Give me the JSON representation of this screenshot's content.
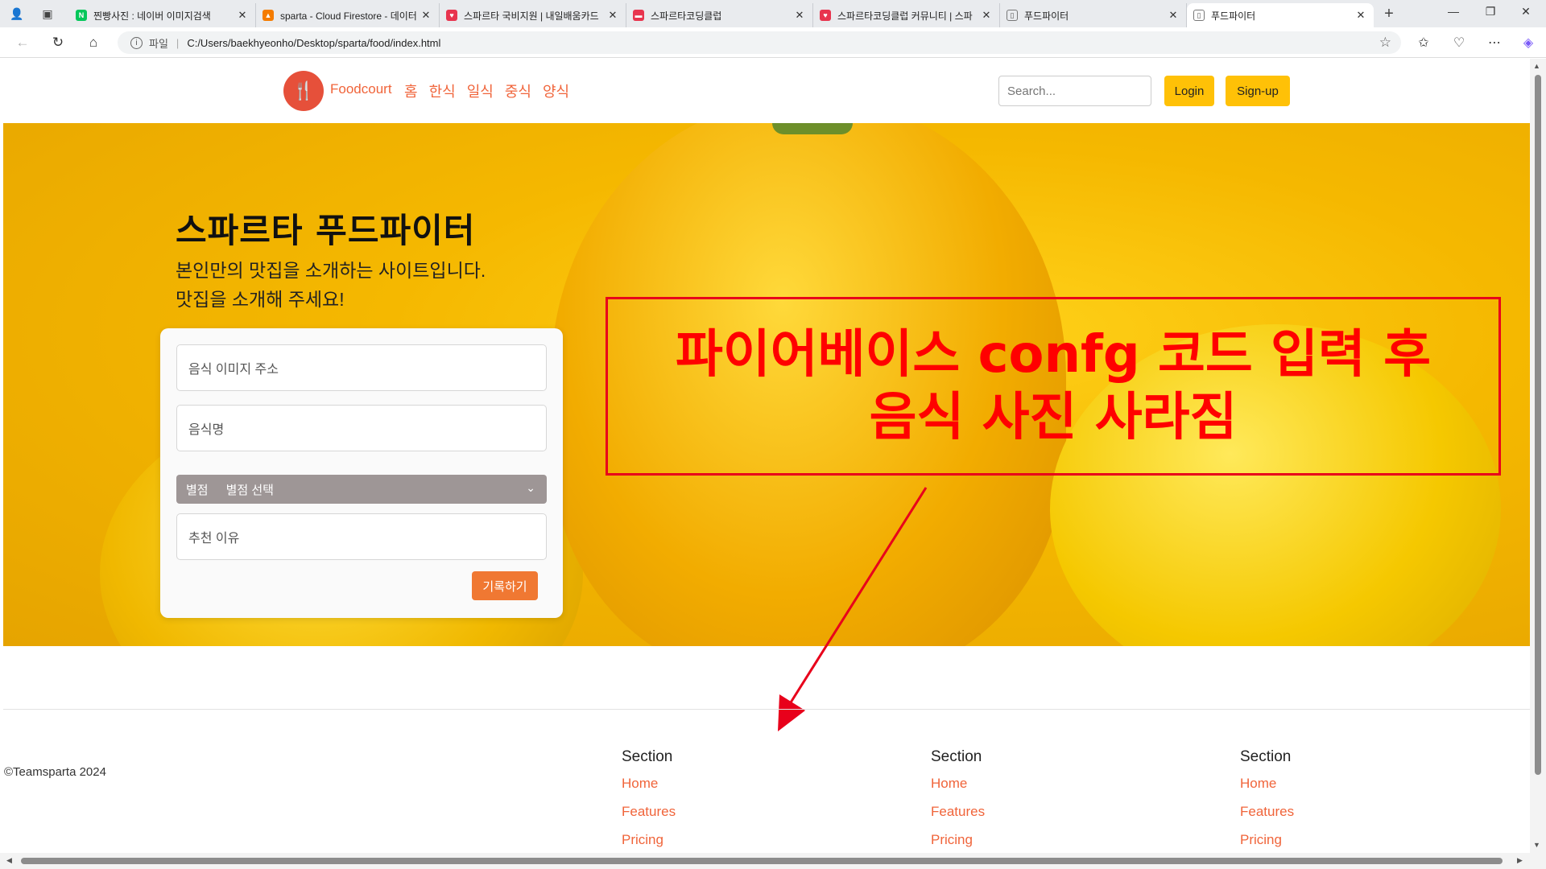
{
  "browser": {
    "tabs": [
      {
        "title": "찐빵사진 : 네이버 이미지검색",
        "favicon": "N",
        "color": "#03c75a"
      },
      {
        "title": "sparta - Cloud Firestore - 데이터",
        "favicon": "▲",
        "color": "#f57c00"
      },
      {
        "title": "스파르타 국비지원 | 내일배움카드",
        "favicon": "♥",
        "color": "#e8344e"
      },
      {
        "title": "스파르타코딩클럽",
        "favicon": "▬",
        "color": "#e8344e"
      },
      {
        "title": "스파르타코딩클럽 커뮤니티 | 스파",
        "favicon": "♥",
        "color": "#e8344e"
      },
      {
        "title": "푸드파이터",
        "favicon": "▯",
        "color": "#888888"
      },
      {
        "title": "푸드파이터",
        "favicon": "▯",
        "color": "#888888"
      }
    ],
    "address": {
      "scheme_label": "파일",
      "url": "C:/Users/baekhyeonho/Desktop/sparta/food/index.html"
    }
  },
  "site": {
    "brand": "Foodcourt",
    "menu": [
      "홈",
      "한식",
      "일식",
      "중식",
      "양식"
    ],
    "search_placeholder": "Search...",
    "login_label": "Login",
    "signup_label": "Sign-up"
  },
  "hero": {
    "title": "스파르타 푸드파이터",
    "subtitle_line1": "본인만의 맛집을 소개하는 사이트입니다.",
    "subtitle_line2": "맛집을 소개해 주세요!"
  },
  "form": {
    "image_placeholder": "음식 이미지 주소",
    "name_placeholder": "음식명",
    "rating_label": "별점",
    "rating_selected": "별점 선택",
    "reason_placeholder": "추천 이유",
    "submit_label": "기록하기"
  },
  "annotation": {
    "line1": "파이어베이스 confg 코드 입력 후",
    "line2": "음식 사진 사라짐",
    "color": "#ff0000"
  },
  "footer": {
    "copyright": "©Teamsparta 2024",
    "columns": [
      {
        "heading": "Section",
        "links": [
          "Home",
          "Features",
          "Pricing"
        ]
      },
      {
        "heading": "Section",
        "links": [
          "Home",
          "Features",
          "Pricing"
        ]
      },
      {
        "heading": "Section",
        "links": [
          "Home",
          "Features",
          "Pricing"
        ]
      }
    ]
  }
}
